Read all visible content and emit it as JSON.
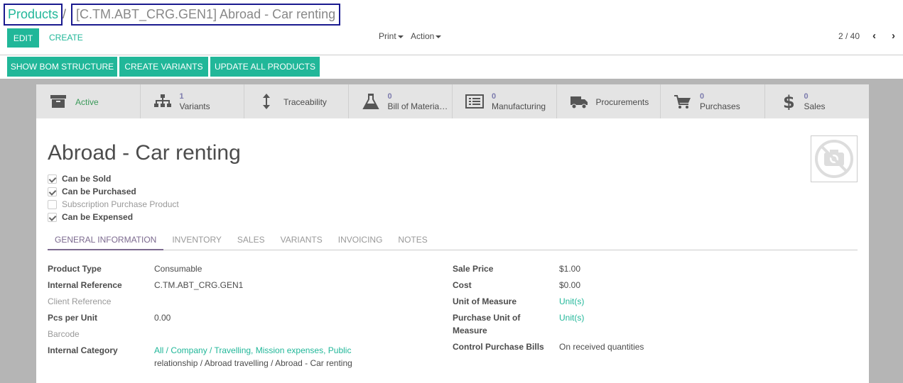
{
  "breadcrumb": {
    "parent": "Products",
    "separator": "/",
    "current": "[C.TM.ABT_CRG.GEN1] Abroad - Car renting"
  },
  "toolbar": {
    "edit_label": "EDIT",
    "create_label": "CREATE",
    "print_label": "Print",
    "action_label": "Action"
  },
  "pager": {
    "value": "2 / 40"
  },
  "header_buttons": {
    "show_bom": "SHOW BOM STRUCTURE",
    "create_variants": "CREATE VARIANTS",
    "update_all": "UPDATE ALL PRODUCTS"
  },
  "stat_buttons": [
    {
      "label": "Active",
      "icon": "archive-icon"
    },
    {
      "count": "1",
      "label": "Variants",
      "icon": "sitemap-icon"
    },
    {
      "label": "Traceability",
      "icon": "arrows-v-icon"
    },
    {
      "count": "0",
      "label": "Bill of Materia…",
      "icon": "flask-icon"
    },
    {
      "count": "0",
      "label": "Manufacturing",
      "icon": "list-alt-icon"
    },
    {
      "label": "Procurements",
      "icon": "truck-icon"
    },
    {
      "count": "0",
      "label": "Purchases",
      "icon": "shopping-cart-icon"
    },
    {
      "count": "0",
      "label": "Sales",
      "icon": "dollar-icon"
    }
  ],
  "product": {
    "name": "Abroad - Car renting",
    "options": [
      {
        "label": "Can be Sold",
        "checked": true
      },
      {
        "label": "Can be Purchased",
        "checked": true
      },
      {
        "label": "Subscription Purchase Product",
        "checked": false
      },
      {
        "label": "Can be Expensed",
        "checked": true
      }
    ]
  },
  "tabs": [
    "GENERAL INFORMATION",
    "INVENTORY",
    "SALES",
    "VARIANTS",
    "INVOICING",
    "NOTES"
  ],
  "left_fields": {
    "product_type": {
      "label": "Product Type",
      "value": "Consumable"
    },
    "internal_ref": {
      "label": "Internal Reference",
      "value": "C.TM.ABT_CRG.GEN1"
    },
    "client_ref": {
      "label": "Client Reference",
      "value": ""
    },
    "pcs_per_unit": {
      "label": "Pcs per Unit",
      "value": "0.00"
    },
    "barcode": {
      "label": "Barcode",
      "value": ""
    },
    "internal_category": {
      "label": "Internal Category",
      "value_line1": "All / Company / Travelling, Mission expenses, Public",
      "value_line2": "relationship / Abroad travelling / Abroad - Car renting"
    }
  },
  "right_fields": {
    "sale_price": {
      "label": "Sale Price",
      "value": "$1.00"
    },
    "cost": {
      "label": "Cost",
      "value": "$0.00"
    },
    "uom": {
      "label": "Unit of Measure",
      "value": "Unit(s)"
    },
    "purchase_uom": {
      "label_line1": "Purchase Unit of",
      "label_line2": "Measure",
      "value": "Unit(s)"
    },
    "control_bills": {
      "label": "Control Purchase Bills",
      "value": "On received quantities"
    }
  },
  "colors": {
    "accent": "#21b799",
    "tab_active": "#7c6a8f",
    "count": "#7c7bad"
  }
}
